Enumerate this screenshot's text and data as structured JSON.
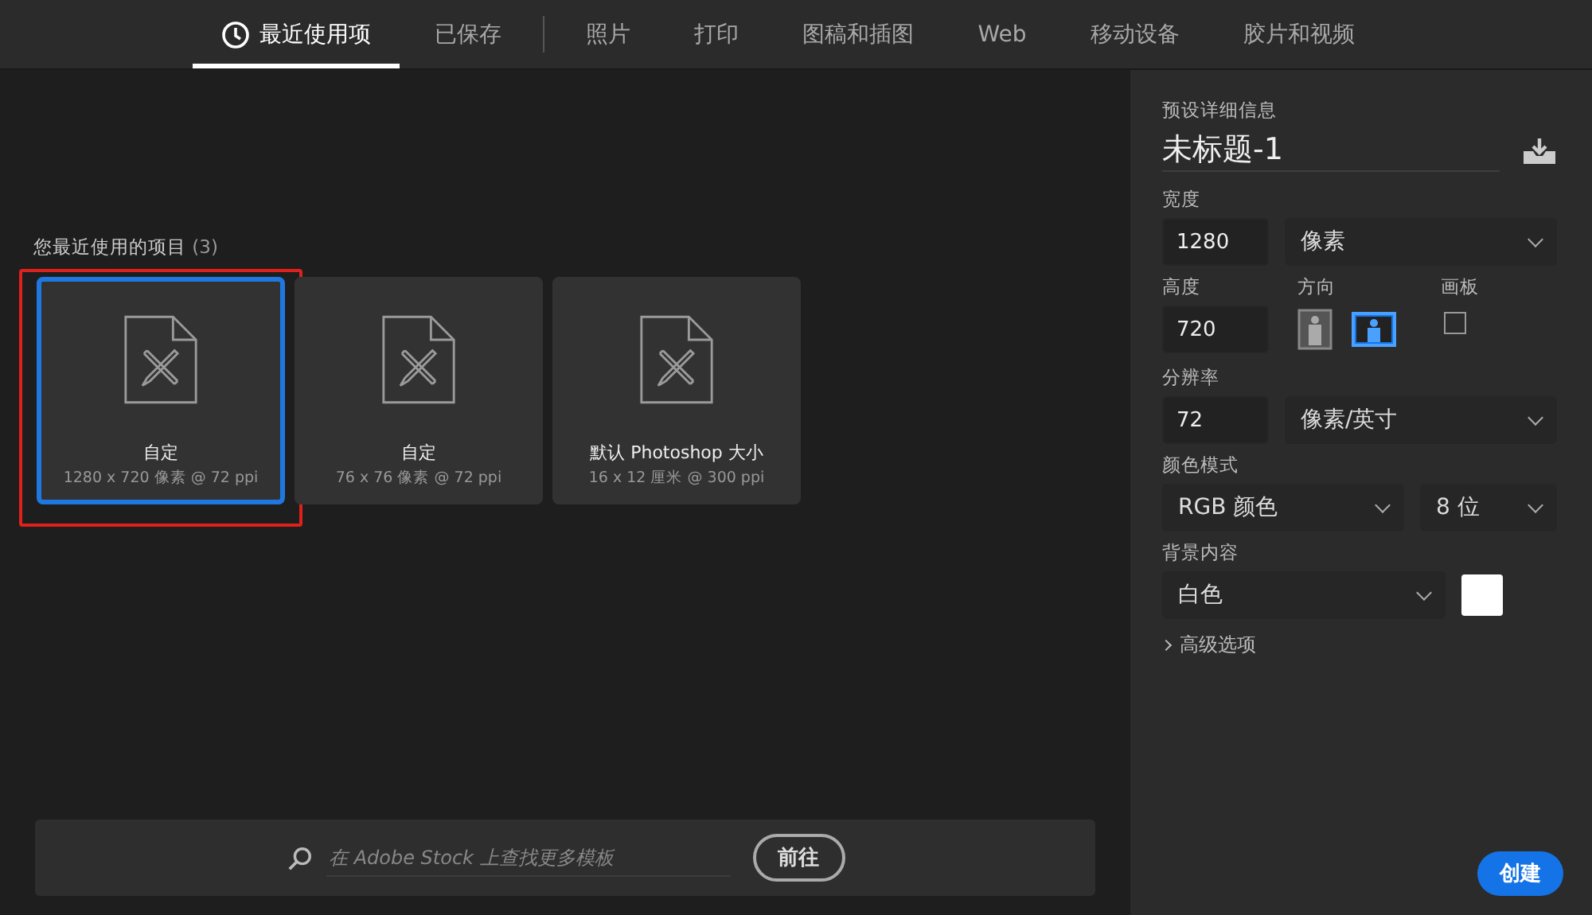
{
  "tabs": [
    {
      "label": "最近使用项",
      "selected": true,
      "icon": true
    },
    {
      "label": "已保存",
      "selected": false
    },
    {
      "label": "照片",
      "selected": false,
      "separator_before": true
    },
    {
      "label": "打印",
      "selected": false
    },
    {
      "label": "图稿和插图",
      "selected": false
    },
    {
      "label": "Web",
      "selected": false
    },
    {
      "label": "移动设备",
      "selected": false
    },
    {
      "label": "胶片和视频",
      "selected": false
    }
  ],
  "recent": {
    "heading": "您最近使用的项目",
    "count": "(3)",
    "items": [
      {
        "name": "自定",
        "size": "1280 x 720 像素 @ 72 ppi",
        "selected": true,
        "highlighted": true
      },
      {
        "name": "自定",
        "size": "76 x 76 像素 @ 72 ppi",
        "selected": false,
        "highlighted": false
      },
      {
        "name": "默认 Photoshop 大小",
        "size": "16 x 12 厘米 @ 300 ppi",
        "selected": false,
        "highlighted": false
      }
    ]
  },
  "search": {
    "placeholder": "在 Adobe Stock 上查找更多模板",
    "button": "前往"
  },
  "details": {
    "heading": "预设详细信息",
    "title": "未标题-1",
    "width": {
      "label": "宽度",
      "value": "1280",
      "unit": "像素"
    },
    "height": {
      "label": "高度",
      "value": "720"
    },
    "orientation": {
      "label": "方向",
      "options": [
        {
          "kind": "portrait",
          "selected": false
        },
        {
          "kind": "landscape",
          "selected": true
        }
      ]
    },
    "artboard": {
      "label": "画板",
      "checked": false
    },
    "resolution": {
      "label": "分辨率",
      "value": "72",
      "unit": "像素/英寸"
    },
    "color_mode": {
      "label": "颜色模式",
      "mode": "RGB 颜色",
      "depth": "8 位"
    },
    "background": {
      "label": "背景内容",
      "value": "白色",
      "color": "#ffffff"
    },
    "advanced": {
      "label": "高级选项",
      "expanded": false
    },
    "create_button": "创建"
  }
}
